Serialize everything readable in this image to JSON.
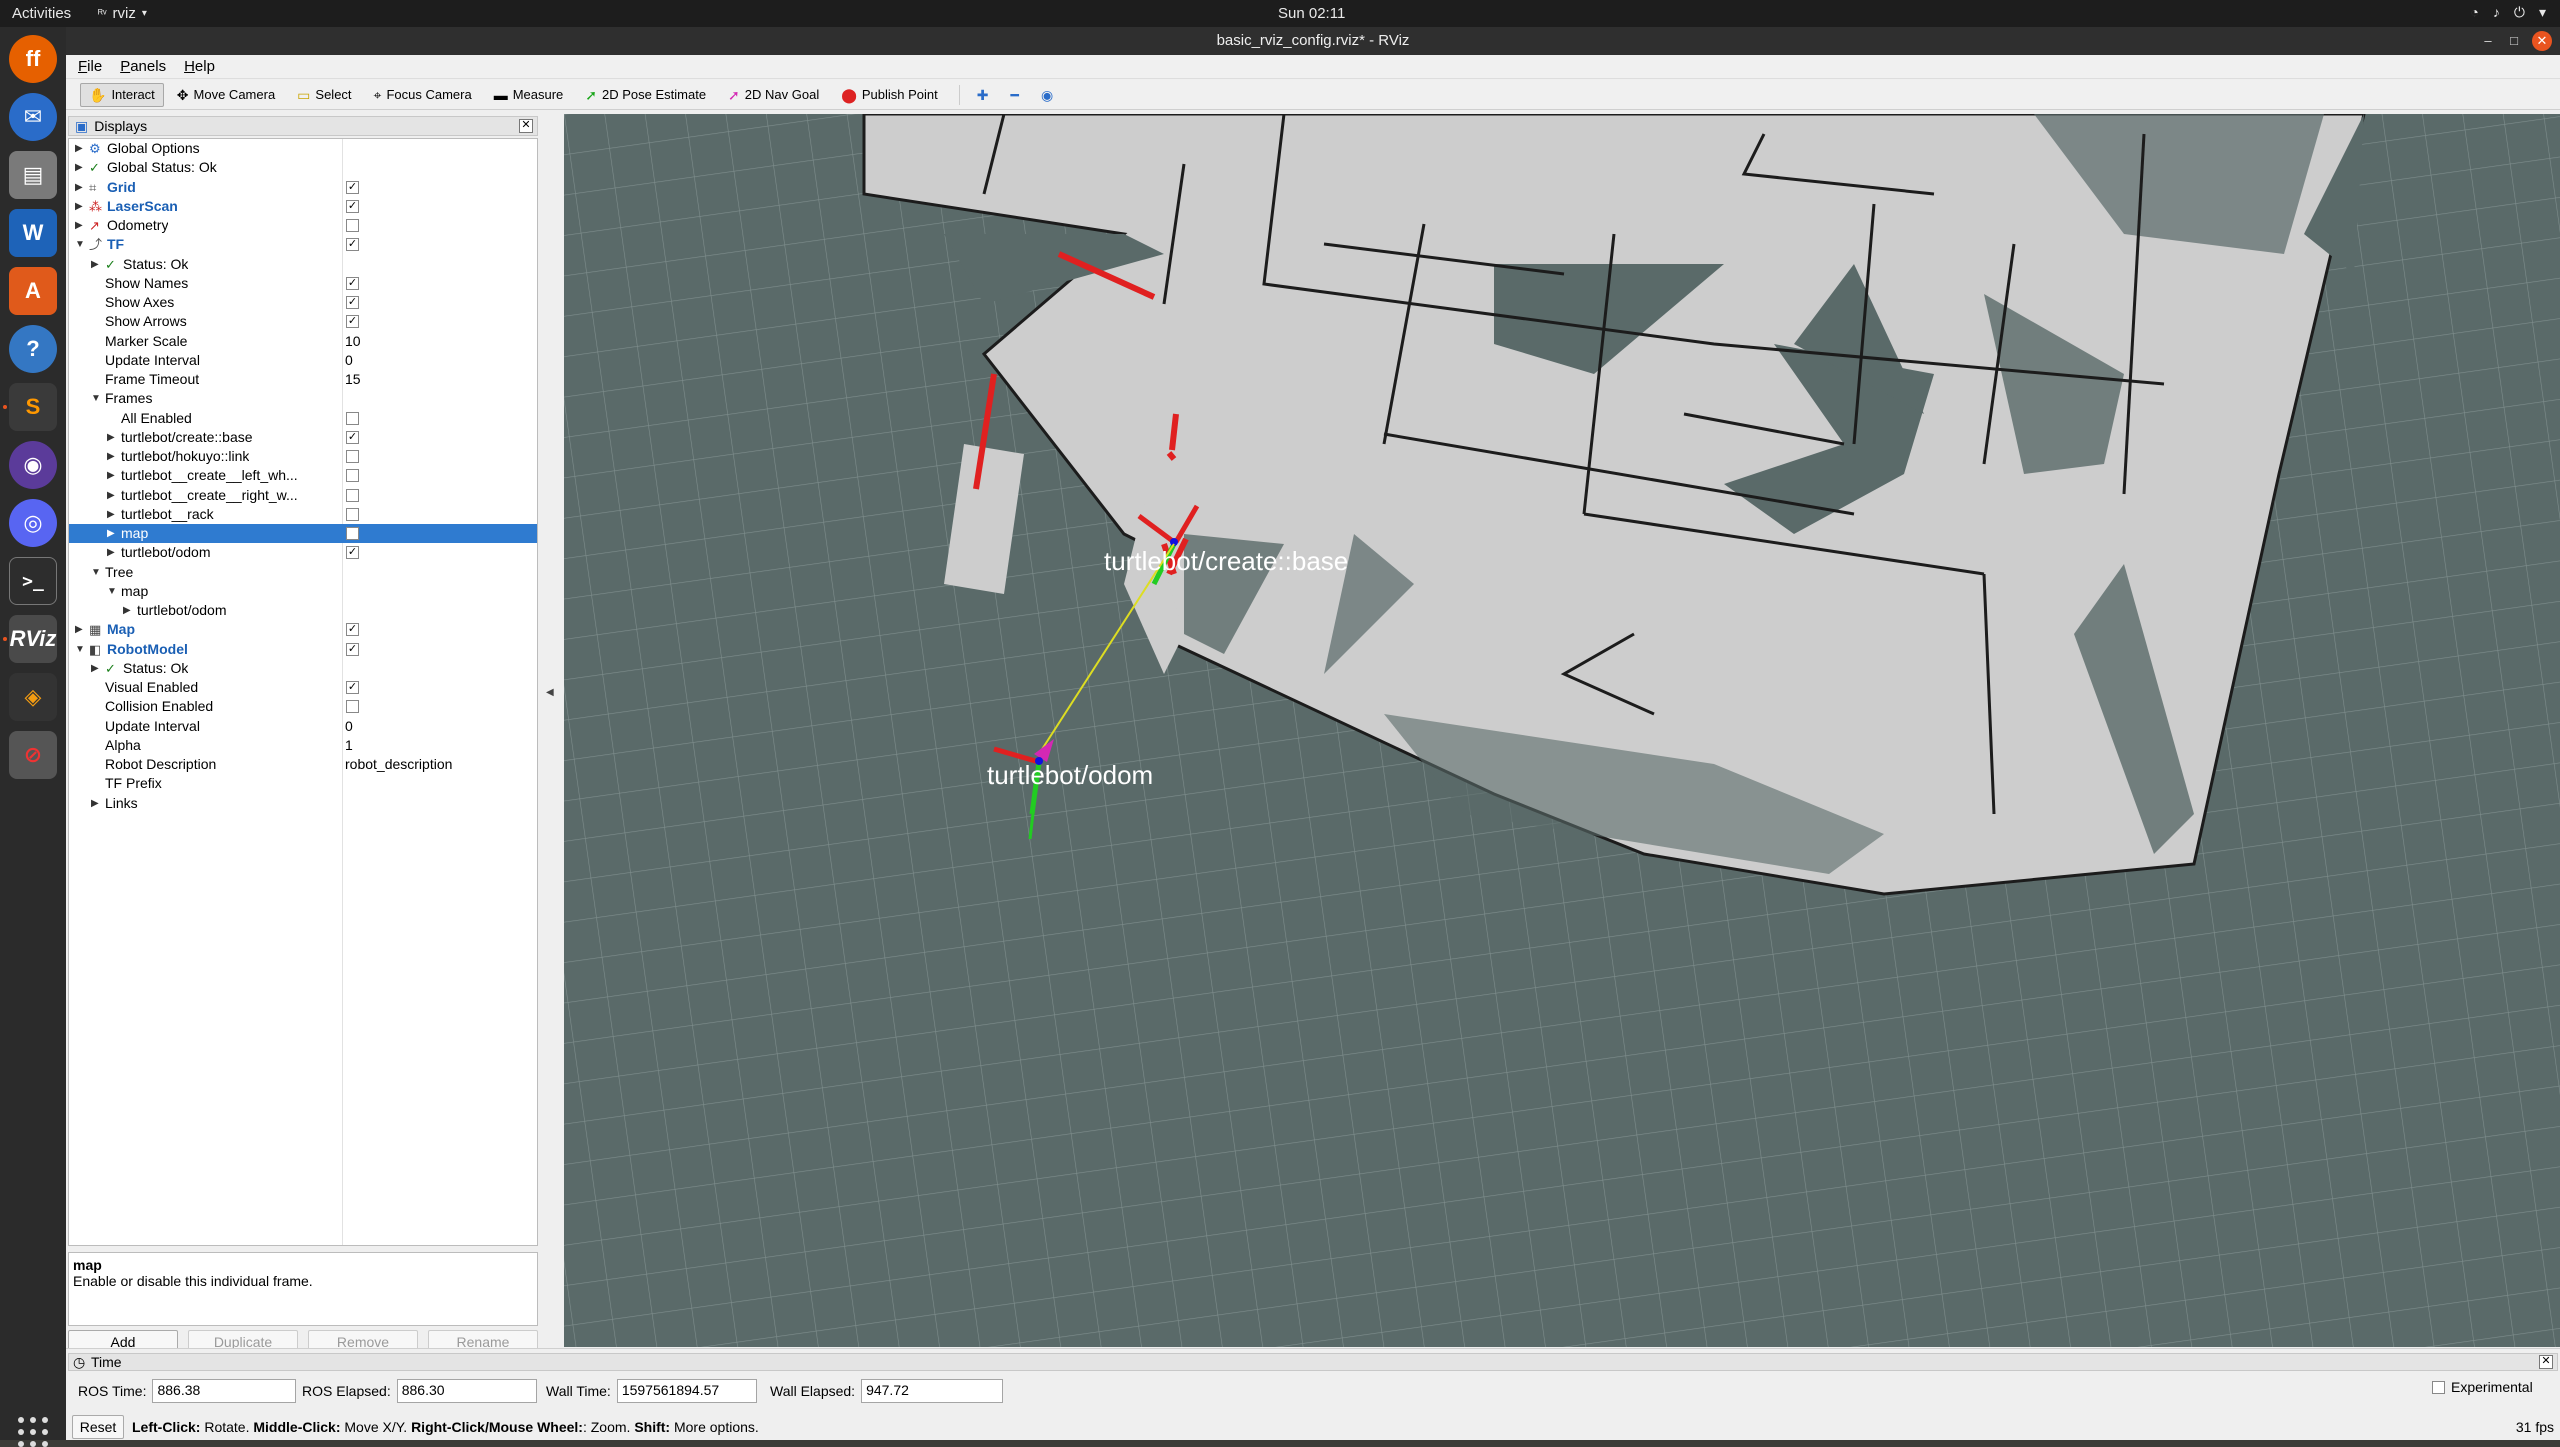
{
  "topbar": {
    "activities": "Activities",
    "app": "rviz",
    "clock": "Sun 02:11"
  },
  "dock": [
    "firefox-icon",
    "thunderbird-icon",
    "files-icon",
    "writer-icon",
    "software-center-icon",
    "help-icon",
    "sublime-icon",
    "github-icon",
    "discord-icon",
    "terminal-icon",
    "rviz-icon",
    "stack-icon",
    "disk-icon"
  ],
  "window": {
    "title": "basic_rviz_config.rviz* - RViz"
  },
  "menu": [
    {
      "first": "F",
      "rest": "ile"
    },
    {
      "first": "P",
      "rest": "anels"
    },
    {
      "first": "H",
      "rest": "elp"
    }
  ],
  "toolbar": {
    "interact": "Interact",
    "move_camera": "Move Camera",
    "select": "Select",
    "focus_camera": "Focus Camera",
    "measure": "Measure",
    "pose_estimate": "2D Pose Estimate",
    "nav_goal": "2D Nav Goal",
    "publish_point": "Publish Point"
  },
  "displays": {
    "title": "Displays",
    "rows": [
      {
        "label": "Global Options",
        "arrow": "▶",
        "ind": 0,
        "icon": "gear"
      },
      {
        "label": "Global Status: Ok",
        "arrow": "▶",
        "ind": 0,
        "icon": "check"
      },
      {
        "label": "Grid",
        "arrow": "▶",
        "ind": 0,
        "icon": "grid",
        "blue": true,
        "cb": true
      },
      {
        "label": "LaserScan",
        "arrow": "▶",
        "ind": 0,
        "icon": "laser",
        "blue": true,
        "cb": true
      },
      {
        "label": "Odometry",
        "arrow": "▶",
        "ind": 0,
        "icon": "odom",
        "cb": false
      },
      {
        "label": "TF",
        "arrow": "▼",
        "ind": 0,
        "icon": "tf",
        "blue": true,
        "cb": true
      },
      {
        "label": "Status: Ok",
        "arrow": "▶",
        "ind": 1,
        "icon": "check"
      },
      {
        "label": "Show Names",
        "ind": 1,
        "cb": true
      },
      {
        "label": "Show Axes",
        "ind": 1,
        "cb": true
      },
      {
        "label": "Show Arrows",
        "ind": 1,
        "cb": true
      },
      {
        "label": "Marker Scale",
        "ind": 1,
        "val": "10"
      },
      {
        "label": "Update Interval",
        "ind": 1,
        "val": "0"
      },
      {
        "label": "Frame Timeout",
        "ind": 1,
        "val": "15"
      },
      {
        "label": "Frames",
        "arrow": "▼",
        "ind": 1
      },
      {
        "label": "All Enabled",
        "ind": 2,
        "cb": false
      },
      {
        "label": "turtlebot/create::base",
        "arrow": "▶",
        "ind": 2,
        "cb": true
      },
      {
        "label": "turtlebot/hokuyo::link",
        "arrow": "▶",
        "ind": 2,
        "cb": false
      },
      {
        "label": "turtlebot__create__left_wh...",
        "arrow": "▶",
        "ind": 2,
        "cb": false
      },
      {
        "label": "turtlebot__create__right_w...",
        "arrow": "▶",
        "ind": 2,
        "cb": false
      },
      {
        "label": "turtlebot__rack",
        "arrow": "▶",
        "ind": 2,
        "cb": false
      },
      {
        "label": "map",
        "arrow": "▶",
        "ind": 2,
        "cb": false,
        "sel": true
      },
      {
        "label": "turtlebot/odom",
        "arrow": "▶",
        "ind": 2,
        "cb": true
      },
      {
        "label": "Tree",
        "arrow": "▼",
        "ind": 1
      },
      {
        "label": "map",
        "arrow": "▼",
        "ind": 2
      },
      {
        "label": "turtlebot/odom",
        "arrow": "▶",
        "ind": 3
      },
      {
        "label": "Map",
        "arrow": "▶",
        "ind": 0,
        "icon": "map",
        "blue": true,
        "cb": true
      },
      {
        "label": "RobotModel",
        "arrow": "▼",
        "ind": 0,
        "icon": "robot",
        "blue": true,
        "cb": true
      },
      {
        "label": "Status: Ok",
        "arrow": "▶",
        "ind": 1,
        "icon": "check"
      },
      {
        "label": "Visual Enabled",
        "ind": 1,
        "cb": true
      },
      {
        "label": "Collision Enabled",
        "ind": 1,
        "cb": false
      },
      {
        "label": "Update Interval",
        "ind": 1,
        "val": "0"
      },
      {
        "label": "Alpha",
        "ind": 1,
        "val": "1"
      },
      {
        "label": "Robot Description",
        "ind": 1,
        "val": "robot_description"
      },
      {
        "label": "TF Prefix",
        "ind": 1
      },
      {
        "label": "Links",
        "arrow": "▶",
        "ind": 1
      }
    ],
    "desc_title": "map",
    "desc_text": "Enable or disable this individual frame.",
    "buttons": {
      "add": "Add",
      "duplicate": "Duplicate",
      "remove": "Remove",
      "rename": "Rename"
    }
  },
  "viewport": {
    "label_base": "turtlebot/create::base",
    "label_odom": "turtlebot/odom"
  },
  "time": {
    "title": "Time",
    "ros_time_label": "ROS Time:",
    "ros_time": "886.38",
    "ros_elapsed_label": "ROS Elapsed:",
    "ros_elapsed": "886.30",
    "wall_time_label": "Wall Time:",
    "wall_time": "1597561894.57",
    "wall_elapsed_label": "Wall Elapsed:",
    "wall_elapsed": "947.72",
    "experimental": "Experimental"
  },
  "status": {
    "reset": "Reset",
    "help_b1": "Left-Click:",
    "help_t1": " Rotate. ",
    "help_b2": "Middle-Click:",
    "help_t2": " Move X/Y. ",
    "help_b3": "Right-Click/Mouse Wheel:",
    "help_t3": ": Zoom. ",
    "help_b4": "Shift:",
    "help_t4": " More options.",
    "fps": "31 fps"
  }
}
